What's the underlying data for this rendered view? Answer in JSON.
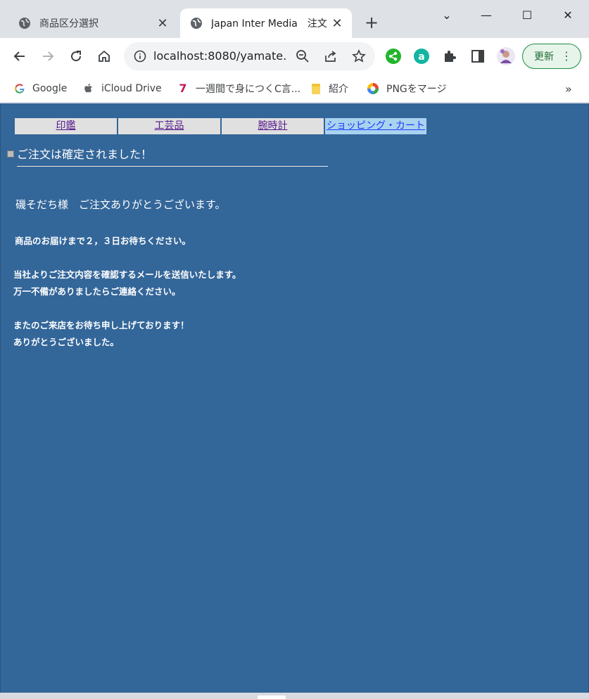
{
  "browser": {
    "tabs": [
      {
        "title": "商品区分選択",
        "state": "inactive"
      },
      {
        "title": "Japan Inter Media　注文",
        "state": "active"
      }
    ],
    "new_tab": "+",
    "close_glyph": "✕",
    "window_controls": {
      "minimize": "—",
      "maximize": "☐",
      "close": "✕",
      "tab_search": "⌄"
    },
    "url": "localhost:8080/yamate...",
    "update_button": "更新",
    "menu_glyph": "⋮",
    "bookmarks": [
      {
        "label": "Google",
        "icon": "google-icon"
      },
      {
        "label": "iCloud Drive",
        "icon": "apple-icon"
      },
      {
        "label": "一週間で身につくC言...",
        "icon": "seven-icon"
      },
      {
        "label": "紹介",
        "icon": "folder-icon"
      },
      {
        "label": "PNGをマージ",
        "icon": "png-merge-icon"
      }
    ],
    "bookmarks_overflow": "»"
  },
  "page": {
    "nav": [
      "印鑑",
      "工芸品",
      "腕時計",
      "ショッピング・カート"
    ],
    "confirm_title": "ご注文は確定されました！",
    "thanks": "磯そだち様　ご注文ありがとうございます。",
    "messages": [
      "商品のお届けまで２，３日お待ちください。",
      "当社よりご注文内容を確認するメールを送信いたします。",
      "万一不備がありましたらご連絡ください。",
      "またのご来店をお待ち申し上げております！",
      "ありがとうございました。"
    ],
    "colors": {
      "page_bg": "#336699",
      "nav_cell": "#e0e0e0",
      "cart_cell": "#a9d3ee"
    }
  }
}
